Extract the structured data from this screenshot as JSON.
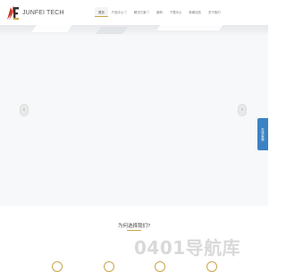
{
  "brand": {
    "name": "JUNFEI TECH",
    "logo_letter": "F"
  },
  "nav": {
    "items": [
      {
        "label": "首页",
        "active": true
      },
      {
        "label": "产品中心 ▽",
        "active": false
      },
      {
        "label": "解决方案 ▽",
        "active": false
      },
      {
        "label": "案例",
        "active": false
      },
      {
        "label": "下载中心",
        "active": false
      },
      {
        "label": "新闻动态",
        "active": false
      },
      {
        "label": "关于我们",
        "active": false
      }
    ]
  },
  "hero": {
    "prev_icon": "‹",
    "next_icon": "›"
  },
  "side_tab": {
    "label": "在线客服"
  },
  "section": {
    "title": "为何选择我们?"
  },
  "watermark": {
    "text": "0401导航库"
  },
  "colors": {
    "accent_gold": "#c9a64a",
    "side_tab_blue": "#3b82c4"
  }
}
